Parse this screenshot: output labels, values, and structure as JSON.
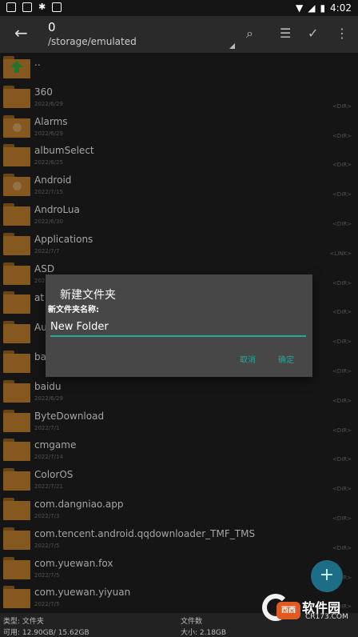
{
  "status_bar": {
    "time": "4:02",
    "battery": "battery-icon"
  },
  "toolbar": {
    "title": "0",
    "path": "/storage/emulated"
  },
  "files": [
    {
      "name": "..",
      "date": "",
      "tag": ""
    },
    {
      "name": "360",
      "date": "2022/6/29",
      "tag": "<DIR>"
    },
    {
      "name": "Alarms",
      "date": "2022/6/29",
      "tag": "<DIR>"
    },
    {
      "name": "albumSelect",
      "date": "2022/6/25",
      "tag": "<DIR>"
    },
    {
      "name": "Android",
      "date": "2022/7/15",
      "tag": "<DIR>"
    },
    {
      "name": "AndroLua",
      "date": "2022/6/30",
      "tag": "<DIR>"
    },
    {
      "name": "Applications",
      "date": "2022/7/7",
      "tag": "<LINK>"
    },
    {
      "name": "ASD",
      "date": "2022/7/7",
      "tag": "<DIR>"
    },
    {
      "name": "at",
      "date": "",
      "tag": "<DIR>"
    },
    {
      "name": "Au",
      "date": "",
      "tag": "<DIR>"
    },
    {
      "name": "ba",
      "date": "",
      "tag": "<DIR>"
    },
    {
      "name": "baidu",
      "date": "2022/6/29",
      "tag": "<DIR>"
    },
    {
      "name": "ByteDownload",
      "date": "2022/7/1",
      "tag": "<DIR>"
    },
    {
      "name": "cmgame",
      "date": "2022/7/14",
      "tag": "<DIR>"
    },
    {
      "name": "ColorOS",
      "date": "2022/7/21",
      "tag": "<DIR>"
    },
    {
      "name": "com.dangniao.app",
      "date": "2022/7/3",
      "tag": "<DIR>"
    },
    {
      "name": "com.tencent.android.qqdownloader_TMF_TMS",
      "date": "2022/7/5",
      "tag": "<DIR>"
    },
    {
      "name": "com.yuewan.fox",
      "date": "2022/7/5",
      "tag": "<DIR>"
    },
    {
      "name": "com.yuewan.yiyuan",
      "date": "2022/7/5",
      "tag": "<DIR>"
    }
  ],
  "dialog": {
    "title": "新建文件夹",
    "label": "新文件夹名称:",
    "value": "New Folder",
    "cancel": "取消",
    "ok": "确定"
  },
  "footer": {
    "type": "类型:  文件夹",
    "free": "可用:  12.90GB/ 15.62GB",
    "count": "文件数",
    "size": "大小:  2.18GB"
  },
  "watermark": {
    "badge": "西西",
    "text": "软件园",
    "sub": "CR173.COM"
  }
}
